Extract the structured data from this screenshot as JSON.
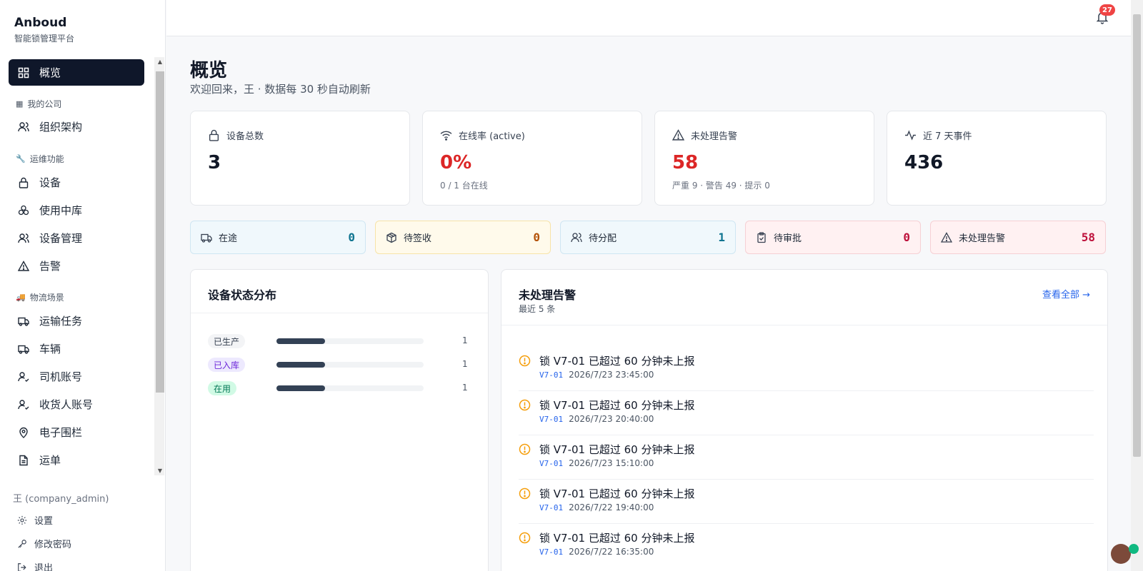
{
  "brand": {
    "name": "Anboud",
    "subtitle": "智能锁管理平台"
  },
  "sidebar": {
    "items": [
      {
        "label": "概览",
        "icon": "dashboard-icon",
        "active": true
      },
      {
        "section": "我的公司",
        "icon": "building-icon"
      },
      {
        "label": "组织架构",
        "icon": "users-icon"
      },
      {
        "section": "运维功能",
        "icon": "wrench-icon"
      },
      {
        "label": "设备",
        "icon": "lock-icon"
      },
      {
        "label": "使用中库",
        "icon": "boxes-icon"
      },
      {
        "label": "设备管理",
        "icon": "users-icon"
      },
      {
        "label": "告警",
        "icon": "warning-icon"
      },
      {
        "section": "物流场景",
        "icon": "truck-icon"
      },
      {
        "label": "运输任务",
        "icon": "truck-icon"
      },
      {
        "label": "车辆",
        "icon": "truck-icon"
      },
      {
        "label": "司机账号",
        "icon": "user-check-icon"
      },
      {
        "label": "收货人账号",
        "icon": "user-check-icon"
      },
      {
        "label": "电子围栏",
        "icon": "map-pin-icon"
      },
      {
        "label": "运单",
        "icon": "file-icon"
      }
    ],
    "user": "王 (company_admin)",
    "footer": [
      {
        "label": "设置",
        "icon": "gear-icon"
      },
      {
        "label": "修改密码",
        "icon": "key-icon"
      },
      {
        "label": "退出",
        "icon": "logout-icon"
      }
    ]
  },
  "topbar": {
    "notifications": "27"
  },
  "page": {
    "title": "概览",
    "subtitle": "欢迎回来，王 · 数据每 30 秒自动刷新"
  },
  "stats": [
    {
      "label": "设备总数",
      "value": "3",
      "note": "",
      "icon": "lock-icon",
      "emphasis": false
    },
    {
      "label": "在线率 (active)",
      "value": "0%",
      "note": "0 / 1 台在线",
      "icon": "wifi-icon",
      "emphasis": true
    },
    {
      "label": "未处理告警",
      "value": "58",
      "note": "严重 9 · 警告 49 · 提示 0",
      "icon": "warning-icon",
      "emphasis": true
    },
    {
      "label": "近 7 天事件",
      "value": "436",
      "note": "",
      "icon": "activity-icon",
      "emphasis": false
    }
  ],
  "pills": [
    {
      "label": "在途",
      "value": "0",
      "icon": "truck-icon",
      "bg": "#f0f8fc",
      "border": "#cfe6f2",
      "color": "#0e7490"
    },
    {
      "label": "待签收",
      "value": "0",
      "icon": "package-icon",
      "bg": "#fffaeb",
      "border": "#f7e3a8",
      "color": "#b45309"
    },
    {
      "label": "待分配",
      "value": "1",
      "icon": "users-icon",
      "bg": "#f0f8fc",
      "border": "#cfe6f2",
      "color": "#0e7490"
    },
    {
      "label": "待审批",
      "value": "0",
      "icon": "clipboard-icon",
      "bg": "#fff1f2",
      "border": "#f6d0d4",
      "color": "#be123c"
    },
    {
      "label": "未处理告警",
      "value": "58",
      "icon": "warning-icon",
      "bg": "#fff1f2",
      "border": "#f6d0d4",
      "color": "#be123c"
    }
  ],
  "distribution": {
    "title": "设备状态分布",
    "rows": [
      {
        "label": "已生产",
        "count": "1",
        "fraction": 0.33,
        "tag_bg": "#f3f4f6",
        "tag_color": "#374151"
      },
      {
        "label": "已入库",
        "count": "1",
        "fraction": 0.33,
        "tag_bg": "#ede9fe",
        "tag_color": "#6d28d9"
      },
      {
        "label": "在用",
        "count": "1",
        "fraction": 0.33,
        "tag_bg": "#d1fae5",
        "tag_color": "#047857"
      }
    ]
  },
  "alerts": {
    "title": "未处理告警",
    "subtitle": "最近 5 条",
    "view_all": "查看全部 →",
    "items": [
      {
        "title": "锁 V7-01 已超过 60 分钟未上报",
        "code": "V7-01",
        "time": "2026/7/23 23:45:00"
      },
      {
        "title": "锁 V7-01 已超过 60 分钟未上报",
        "code": "V7-01",
        "time": "2026/7/23 20:40:00"
      },
      {
        "title": "锁 V7-01 已超过 60 分钟未上报",
        "code": "V7-01",
        "time": "2026/7/23 15:10:00"
      },
      {
        "title": "锁 V7-01 已超过 60 分钟未上报",
        "code": "V7-01",
        "time": "2026/7/22 19:40:00"
      },
      {
        "title": "锁 V7-01 已超过 60 分钟未上报",
        "code": "V7-01",
        "time": "2026/7/22 16:35:00"
      }
    ]
  },
  "colors": {
    "accent": "#0f172a",
    "danger": "#dc2626",
    "link": "#2563eb",
    "warning": "#f59e0b"
  }
}
